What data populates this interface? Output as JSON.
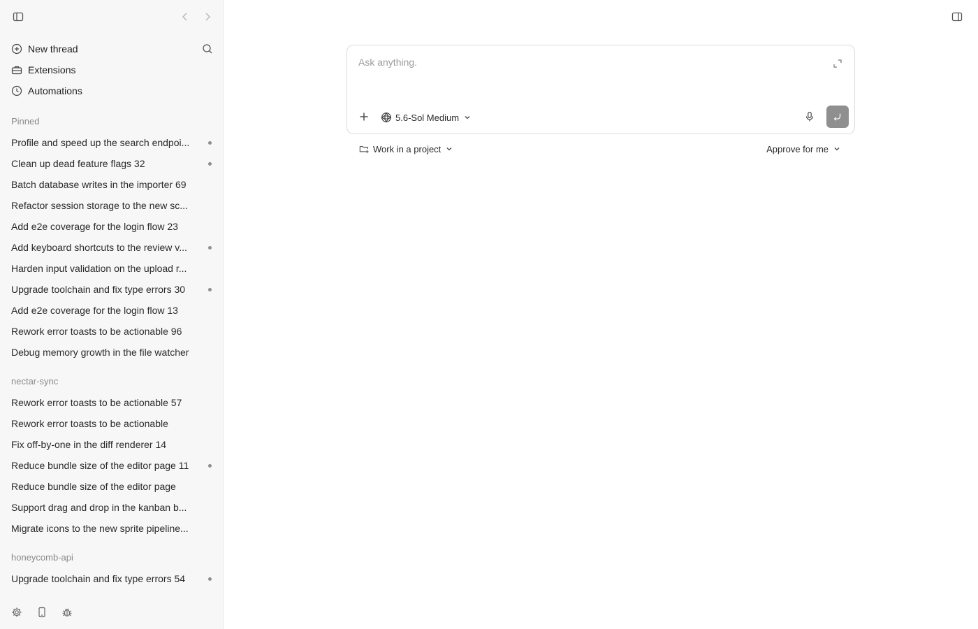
{
  "sidebar": {
    "nav": [
      {
        "label": "New thread",
        "icon": "plus-circle-icon"
      },
      {
        "label": "Extensions",
        "icon": "toolbox-icon"
      },
      {
        "label": "Automations",
        "icon": "clock-icon"
      }
    ],
    "sections": [
      {
        "label": "Pinned",
        "threads": [
          {
            "title": "Profile and speed up the search endpoi...",
            "dot": true
          },
          {
            "title": "Clean up dead feature flags 32",
            "dot": true
          },
          {
            "title": "Batch database writes in the importer 69",
            "dot": false
          },
          {
            "title": "Refactor session storage to the new sc...",
            "dot": false
          },
          {
            "title": "Add e2e coverage for the login flow 23",
            "dot": false
          },
          {
            "title": "Add keyboard shortcuts to the review v...",
            "dot": true
          },
          {
            "title": "Harden input validation on the upload r...",
            "dot": false
          },
          {
            "title": "Upgrade toolchain and fix type errors 30",
            "dot": true
          },
          {
            "title": "Add e2e coverage for the login flow 13",
            "dot": false
          },
          {
            "title": "Rework error toasts to be actionable 96",
            "dot": false
          },
          {
            "title": "Debug memory growth in the file watcher",
            "dot": false
          }
        ]
      },
      {
        "label": "nectar-sync",
        "threads": [
          {
            "title": "Rework error toasts to be actionable 57",
            "dot": false
          },
          {
            "title": "Rework error toasts to be actionable",
            "dot": false
          },
          {
            "title": "Fix off-by-one in the diff renderer 14",
            "dot": false
          },
          {
            "title": "Reduce bundle size of the editor page 11",
            "dot": true
          },
          {
            "title": "Reduce bundle size of the editor page",
            "dot": false
          },
          {
            "title": "Support drag and drop in the kanban b...",
            "dot": false
          },
          {
            "title": "Migrate icons to the new sprite pipeline...",
            "dot": false
          }
        ]
      },
      {
        "label": "honeycomb-api",
        "threads": [
          {
            "title": "Upgrade toolchain and fix type errors 54",
            "dot": true
          }
        ]
      }
    ]
  },
  "composer": {
    "placeholder": "Ask anything.",
    "model": "5.6-Sol Medium"
  },
  "options": {
    "project": "Work in a project",
    "approval": "Approve for me"
  },
  "colors": {
    "sidebar_bg": "#f7f7f7",
    "send_button": "#8f8f8f",
    "dot": "#8e8e8e"
  }
}
